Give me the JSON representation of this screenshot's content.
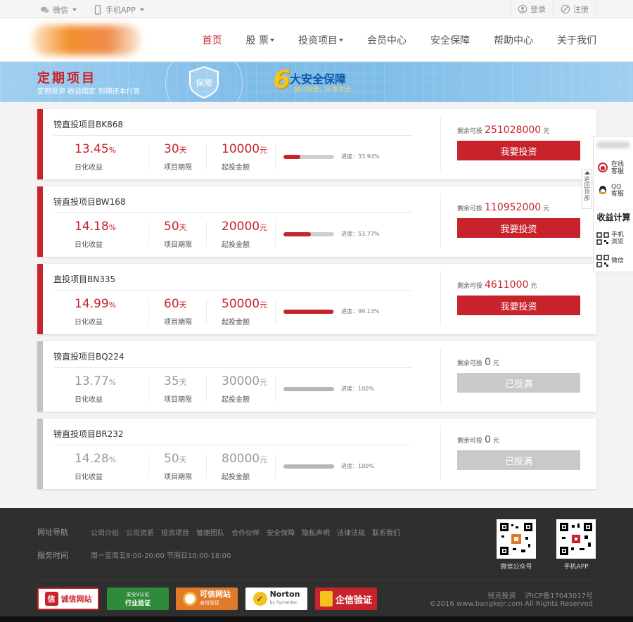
{
  "topbar": {
    "wechat": "微信",
    "app": "手机APP",
    "login": "登录",
    "register": "注册"
  },
  "nav": {
    "items": [
      "首页",
      "股 票",
      "投资项目",
      "会员中心",
      "安全保障",
      "帮助中心",
      "关于我们"
    ]
  },
  "banner": {
    "title": "定期项目",
    "subtitle": "定期投资 收益固定 到期还本付息",
    "shield": "保障",
    "six": "6",
    "big_text": "大安全保障",
    "small_text": "放心投资，乐享生活"
  },
  "labels": {
    "rate": "日化收益",
    "period": "项目期限",
    "min": "起投金额",
    "remain": "剩余可投",
    "yuan": "元",
    "day": "天",
    "pct": "%",
    "progress_prefix": "进度："
  },
  "projects": [
    {
      "name": "镑直投项目BK868",
      "rate": "13.45",
      "days": "30",
      "min": "10000",
      "progress_text": "33.94%",
      "progress": 33.94,
      "remain": "251028000",
      "button": "我要投资",
      "done": false
    },
    {
      "name": "镑直投项目BW168",
      "rate": "14.18",
      "days": "50",
      "min": "20000",
      "progress_text": "53.77%",
      "progress": 53.77,
      "remain": "110952000",
      "button": "我要投资",
      "done": false
    },
    {
      "name": "直投项目BN335",
      "rate": "14.99",
      "days": "60",
      "min": "50000",
      "progress_text": "99.13%",
      "progress": 99.13,
      "remain": "4611000",
      "button": "我要投资",
      "done": false
    },
    {
      "name": "镑直投项目BQ224",
      "rate": "13.77",
      "days": "35",
      "min": "30000",
      "progress_text": "100%",
      "progress": 100,
      "remain": "0",
      "button": "已投满",
      "done": true
    },
    {
      "name": "镑直投项目BR232",
      "rate": "14.28",
      "days": "50",
      "min": "80000",
      "progress_text": "100%",
      "progress": 100,
      "remain": "0",
      "button": "已投满",
      "done": true
    }
  ],
  "sidebar": {
    "online": "在线客服",
    "qq": "QQ客服",
    "calc": "收益计算",
    "mobile": "手机浏览",
    "wechat": "微信",
    "backtop": "返回顶部"
  },
  "footer": {
    "nav_label": "网址导航",
    "links": [
      "公司介绍",
      "公司资质",
      "投资项目",
      "管理团队",
      "合作伙伴",
      "安全保障",
      "隐私声明",
      "法律法规",
      "联系我们"
    ],
    "time_label": "服务时间",
    "time_value": "周一至周五9:00-20:00 节假日10:00-18:00",
    "qr1": "微信公众号",
    "qr2": "手机APP",
    "icp": "镑克投资    沪ICP备17043017号",
    "copyright": "©2016 www.bangkejr.com All Rights Reserved",
    "badges": [
      "诚信网站",
      "行业验证",
      "可信网站",
      "Norton",
      "企信验证"
    ],
    "badge_sub": [
      "安全V认证",
      "身份验证",
      "by Symantec"
    ]
  },
  "colors": {
    "accent": "#c8232c",
    "muted": "#c3c3c3",
    "banner": "#7fbde9",
    "footer": "#2f2f2f"
  }
}
